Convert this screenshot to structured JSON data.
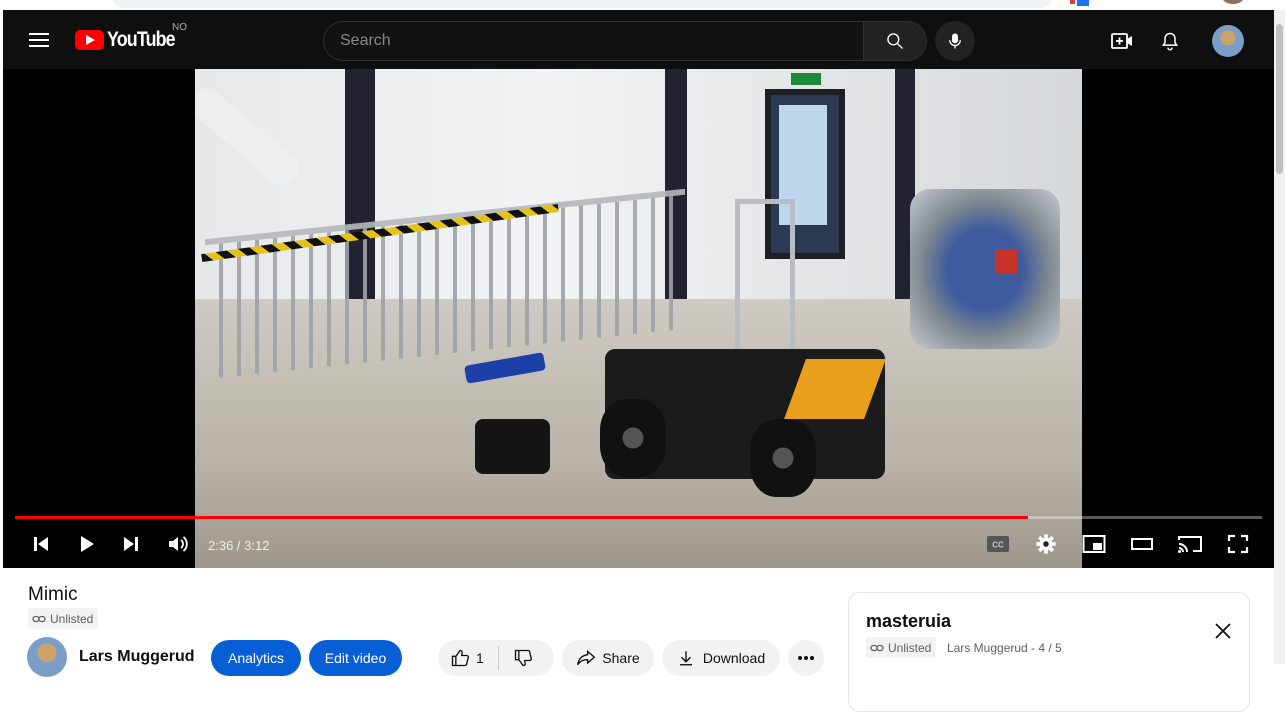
{
  "masthead": {
    "logo_text": "YouTube",
    "country_code": "NO",
    "search_placeholder": "Search"
  },
  "player": {
    "current_time": "2:36",
    "duration": "3:12",
    "time_display": "2:36 / 3:12",
    "progress_fraction": 0.8125,
    "progress_color": "#ff0000"
  },
  "video": {
    "title": "Mimic",
    "visibility": "Unlisted"
  },
  "channel": {
    "name": "Lars Muggerud"
  },
  "actions": {
    "analytics_label": "Analytics",
    "edit_label": "Edit video",
    "like_count": "1",
    "share_label": "Share",
    "download_label": "Download"
  },
  "playlist": {
    "title": "masteruia",
    "visibility": "Unlisted",
    "meta": "Lars Muggerud - 4 / 5"
  },
  "colors": {
    "accent_blue": "#065fd4",
    "brand_red": "#ff0000"
  }
}
